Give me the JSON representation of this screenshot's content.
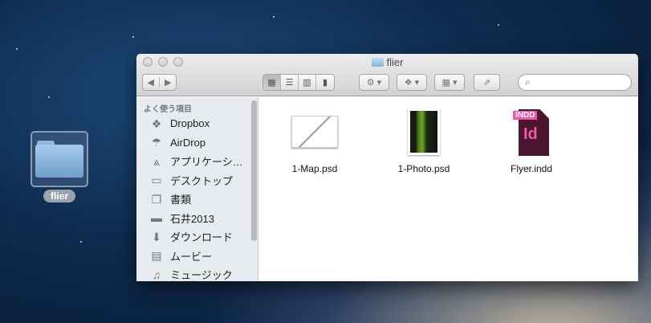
{
  "desktop": {
    "folder_label": "flier"
  },
  "window": {
    "title": "flier",
    "search_placeholder": ""
  },
  "toolbar": {
    "back": "◀",
    "forward": "▶",
    "views": [
      "icon",
      "list",
      "column",
      "coverflow"
    ]
  },
  "sidebar": {
    "section": "よく使う項目",
    "items": [
      {
        "label": "Dropbox",
        "icon": "dropbox-icon",
        "glyph": "❖"
      },
      {
        "label": "AirDrop",
        "icon": "airdrop-icon",
        "glyph": "☂"
      },
      {
        "label": "アプリケーシ…",
        "icon": "applications-icon",
        "glyph": "⩓"
      },
      {
        "label": "デスクトップ",
        "icon": "desktop-icon",
        "glyph": "▭"
      },
      {
        "label": "書類",
        "icon": "documents-icon",
        "glyph": "❐"
      },
      {
        "label": "石井2013",
        "icon": "folder-icon",
        "glyph": "▬"
      },
      {
        "label": "ダウンロード",
        "icon": "downloads-icon",
        "glyph": "⬇"
      },
      {
        "label": "ムービー",
        "icon": "movies-icon",
        "glyph": "▤"
      },
      {
        "label": "ミュージック",
        "icon": "music-icon",
        "glyph": "♫"
      }
    ]
  },
  "files": [
    {
      "name": "1-Map.psd"
    },
    {
      "name": "1-Photo.psd"
    },
    {
      "name": "Flyer.indd",
      "badge": "INDD",
      "glyph": "Id"
    }
  ]
}
